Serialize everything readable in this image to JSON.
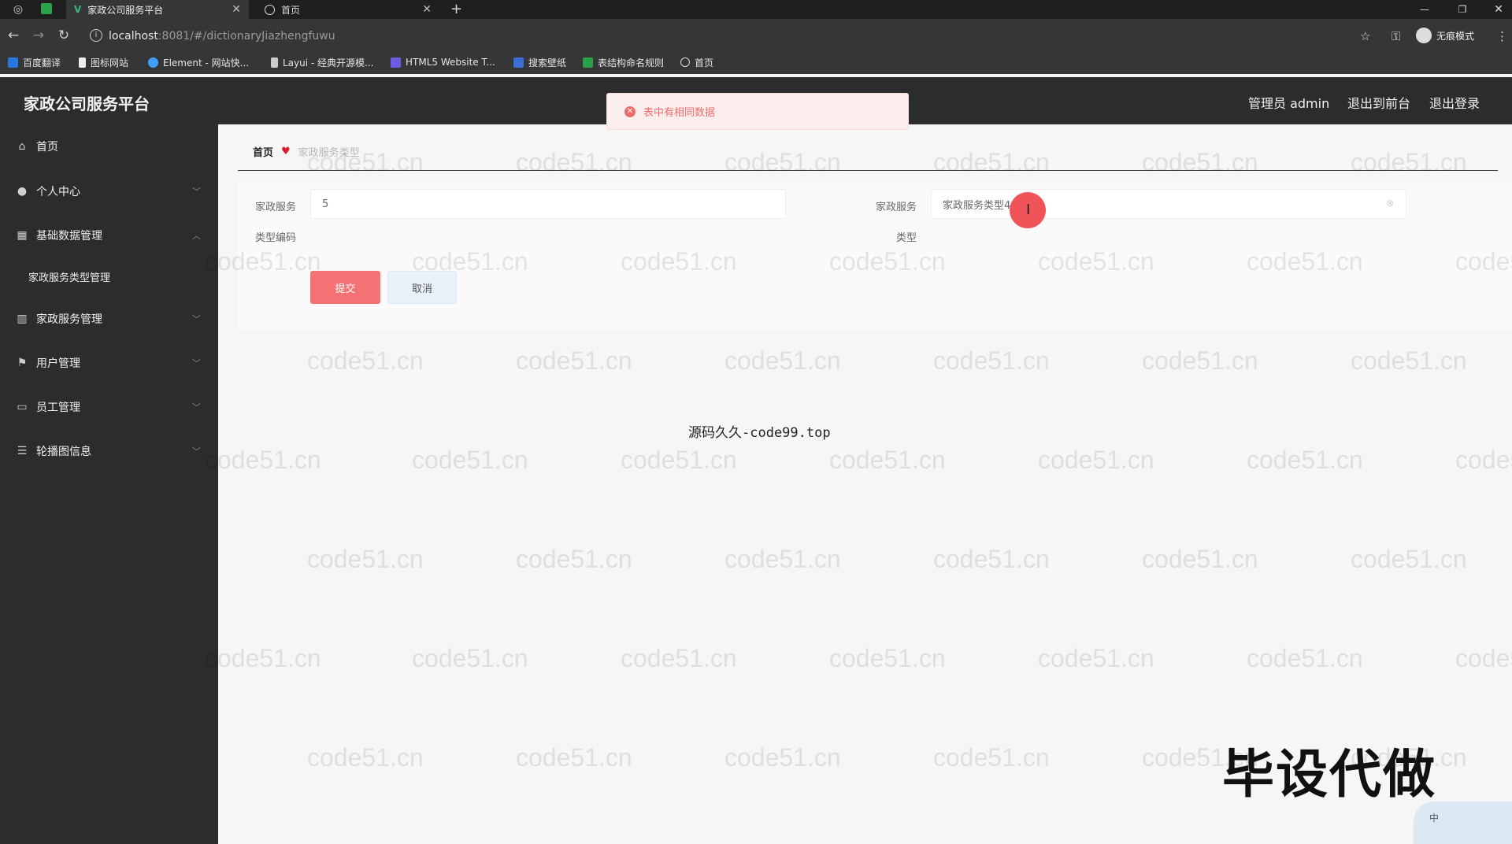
{
  "browser": {
    "tabs": [
      {
        "title": "家政公司服务平台",
        "active": true
      },
      {
        "title": "首页",
        "active": false
      }
    ],
    "new_tab": "+",
    "url_host": "localhost",
    "url_rest": ":8081/#/dictionaryJiazhengfuwu",
    "incognito_label": "无痕模式",
    "bookmarks": [
      "百度翻译",
      "图标网站",
      "Element - 网站快...",
      "Layui - 经典开源模...",
      "HTML5 Website T...",
      "搜索壁纸",
      "表结构命名规则",
      "首页"
    ]
  },
  "header": {
    "title": "家政公司服务平台",
    "admin": "管理员 admin",
    "back_front": "退出到前台",
    "logout": "退出登录"
  },
  "alert": {
    "message": "表中有相同数据"
  },
  "sidebar": {
    "items": [
      {
        "label": "首页",
        "icon": "home-icon"
      },
      {
        "label": "个人中心",
        "icon": "user-icon"
      },
      {
        "label": "基础数据管理",
        "icon": "grid-icon"
      },
      {
        "label": "家政服务管理",
        "icon": "chart-icon"
      },
      {
        "label": "用户管理",
        "icon": "flag-icon"
      },
      {
        "label": "员工管理",
        "icon": "card-icon"
      },
      {
        "label": "轮播图信息",
        "icon": "list-icon"
      }
    ],
    "sub_item": "家政服务类型管理"
  },
  "breadcrumb": {
    "home": "首页",
    "current": "家政服务类型"
  },
  "form": {
    "field1_label_a": "家政服务",
    "field1_label_b": "类型编码",
    "field1_value": "5",
    "field2_label_a": "家政服务",
    "field2_label_b": "类型",
    "field2_value": "家政服务类型4",
    "submit": "提交",
    "cancel": "取消"
  },
  "overlay": {
    "center_text": "源码久久-code99.top",
    "watermark": "code51.cn",
    "stamp": "毕设代做",
    "ime_label": "中"
  }
}
